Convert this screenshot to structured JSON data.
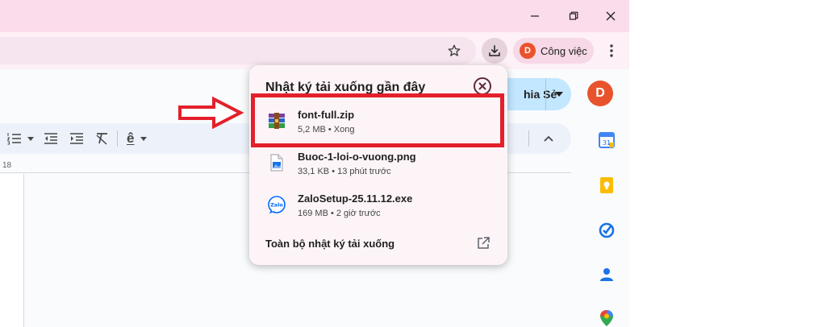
{
  "browser": {
    "profile": {
      "initial": "D",
      "label": "Công việc"
    }
  },
  "app": {
    "share_button_label": "hia Sẻ",
    "user_initial": "D",
    "ruler_number": "18",
    "heading_style_glyph": "ê"
  },
  "downloads_popup": {
    "title": "Nhật ký tải xuống gần đây",
    "items": [
      {
        "name": "font-full.zip",
        "meta": "5,2 MB • Xong",
        "icon": "winrar-archive-icon"
      },
      {
        "name": "Buoc-1-loi-o-vuong.png",
        "meta": "33,1 KB • 13 phút trước",
        "icon": "image-file-icon"
      },
      {
        "name": "ZaloSetup-25.11.12.exe",
        "meta": "169 MB • 2 giờ trước",
        "icon": "zalo-icon"
      }
    ],
    "footer_link": "Toàn bộ nhật ký tải xuống"
  },
  "colors": {
    "titlebar": "#fbdcea",
    "accent_avatar": "#e8532d",
    "highlight": "#e3202b",
    "share_button": "#c2e7ff"
  }
}
